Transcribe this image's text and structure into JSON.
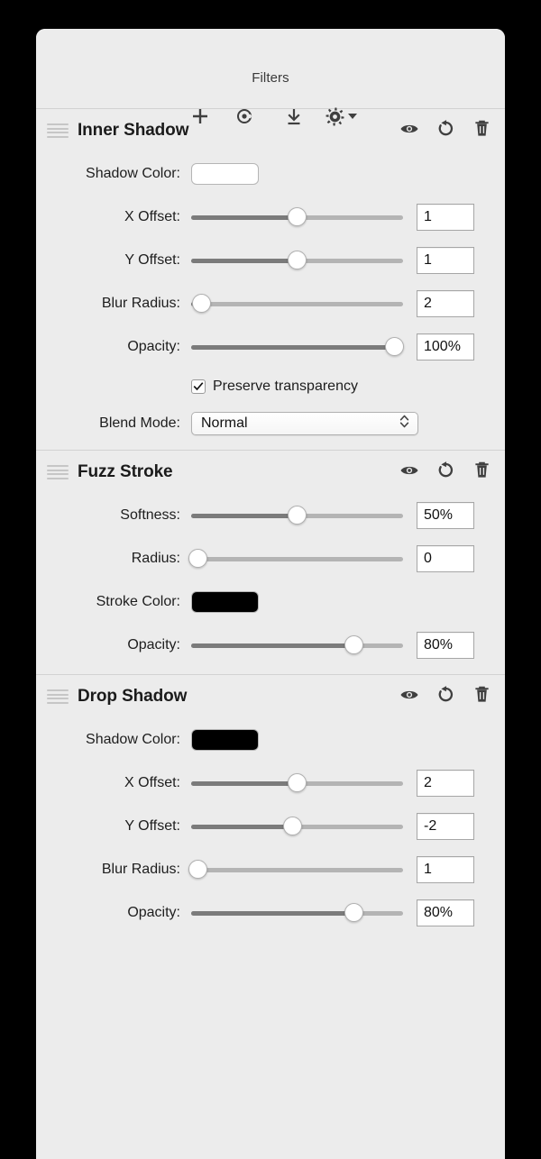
{
  "window": {
    "title": "Filters"
  },
  "toolbar": {
    "add_label": "plus-icon",
    "clone_label": "clone-icon",
    "download_label": "download-icon",
    "settings_label": "gear-icon"
  },
  "section_actions": {
    "visibility": "eye-icon",
    "reset": "reset-icon",
    "delete": "trash-icon"
  },
  "colors": {
    "panel_bg": "#ececec",
    "slider_fill": "#7b7b7b",
    "slider_rail": "#b4b4b4",
    "text": "#1d1d1d"
  },
  "sections": [
    {
      "title": "Inner Shadow",
      "rows": [
        {
          "kind": "color",
          "label": "Shadow Color:",
          "value": "#ffffff"
        },
        {
          "kind": "slider",
          "label": "X Offset:",
          "value": "1",
          "percent": 50
        },
        {
          "kind": "slider",
          "label": "Y Offset:",
          "value": "1",
          "percent": 50
        },
        {
          "kind": "slider",
          "label": "Blur Radius:",
          "value": "2",
          "percent": 5
        },
        {
          "kind": "slider",
          "label": "Opacity:",
          "value": "100%",
          "percent": 96
        },
        {
          "kind": "checkbox",
          "label": "Preserve transparency",
          "checked": true
        },
        {
          "kind": "select",
          "label": "Blend Mode:",
          "value": "Normal"
        }
      ]
    },
    {
      "title": "Fuzz Stroke",
      "rows": [
        {
          "kind": "slider",
          "label": "Softness:",
          "value": "50%",
          "percent": 50
        },
        {
          "kind": "slider",
          "label": "Radius:",
          "value": "0",
          "percent": 3
        },
        {
          "kind": "color",
          "label": "Stroke Color:",
          "value": "#000000"
        },
        {
          "kind": "slider",
          "label": "Opacity:",
          "value": "80%",
          "percent": 77
        }
      ]
    },
    {
      "title": "Drop Shadow",
      "rows": [
        {
          "kind": "color",
          "label": "Shadow Color:",
          "value": "#000000"
        },
        {
          "kind": "slider",
          "label": "X Offset:",
          "value": "2",
          "percent": 50
        },
        {
          "kind": "slider",
          "label": "Y Offset:",
          "value": "-2",
          "percent": 48
        },
        {
          "kind": "slider",
          "label": "Blur Radius:",
          "value": "1",
          "percent": 3
        },
        {
          "kind": "slider",
          "label": "Opacity:",
          "value": "80%",
          "percent": 77
        }
      ]
    }
  ]
}
